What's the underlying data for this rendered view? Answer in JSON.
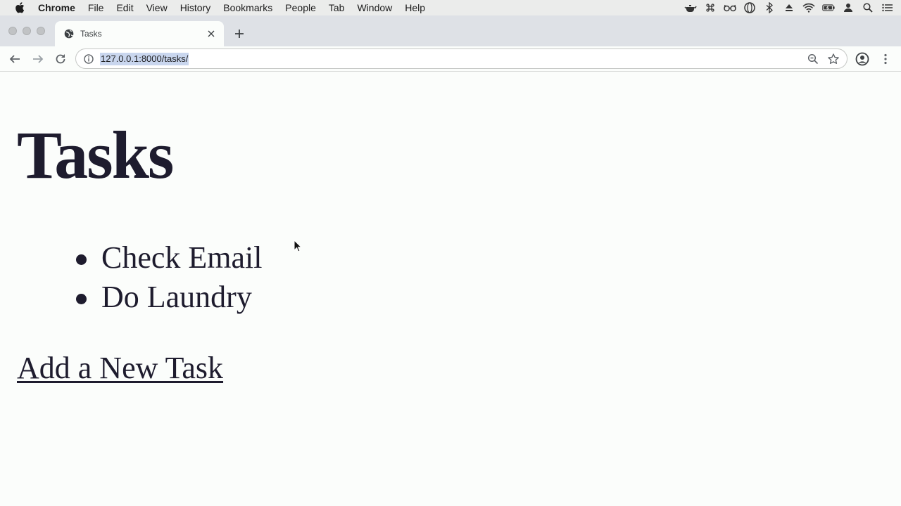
{
  "menubar": {
    "app_name": "Chrome",
    "items": [
      "File",
      "Edit",
      "View",
      "History",
      "Bookmarks",
      "People",
      "Tab",
      "Window",
      "Help"
    ],
    "status_icons": [
      "teapot-icon",
      "command-icon",
      "glasses-icon",
      "vpn-icon",
      "bluetooth-icon",
      "eject-icon",
      "wifi-icon",
      "battery-icon",
      "user-icon",
      "spotlight-icon",
      "notification-center-icon"
    ]
  },
  "tab": {
    "title": "Tasks",
    "favicon": "globe-icon"
  },
  "toolbar": {
    "url": "127.0.0.1:8000/tasks/"
  },
  "page": {
    "heading": "Tasks",
    "tasks": [
      "Check Email",
      "Do Laundry"
    ],
    "add_link": "Add a New Task"
  },
  "colors": {
    "page_bg": "#fbfdfb",
    "text": "#1e1c2e",
    "tabstrip_bg": "#dee1e6",
    "menubar_bg": "#ebeceb",
    "url_selection": "#c9d6ee"
  }
}
